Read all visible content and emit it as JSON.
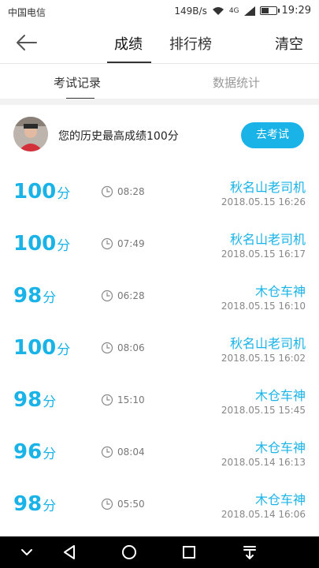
{
  "status_bar": {
    "carrier": "中国电信",
    "speed": "149B/s",
    "network_small": "4G",
    "time": "19:29"
  },
  "header": {
    "tabs": [
      {
        "label": "成绩",
        "active": true
      },
      {
        "label": "排行榜",
        "active": false
      }
    ],
    "clear_label": "清空"
  },
  "sub_tabs": [
    {
      "label": "考试记录",
      "active": true
    },
    {
      "label": "数据统计",
      "active": false
    }
  ],
  "best": {
    "text": "您的历史最高成绩100分",
    "exam_button": "去考试"
  },
  "records": [
    {
      "score": "100",
      "unit": "分",
      "duration": "08:28",
      "name": "秋名山老司机",
      "datetime": "2018.05.15  16:26"
    },
    {
      "score": "100",
      "unit": "分",
      "duration": "07:49",
      "name": "秋名山老司机",
      "datetime": "2018.05.15  16:17"
    },
    {
      "score": "98",
      "unit": "分",
      "duration": "06:28",
      "name": "木仓车神",
      "datetime": "2018.05.15  16:10"
    },
    {
      "score": "100",
      "unit": "分",
      "duration": "08:06",
      "name": "秋名山老司机",
      "datetime": "2018.05.15  16:02"
    },
    {
      "score": "98",
      "unit": "分",
      "duration": "15:10",
      "name": "木仓车神",
      "datetime": "2018.05.15  15:45"
    },
    {
      "score": "96",
      "unit": "分",
      "duration": "08:04",
      "name": "木仓车神",
      "datetime": "2018.05.14  16:13"
    },
    {
      "score": "98",
      "unit": "分",
      "duration": "05:50",
      "name": "木仓车神",
      "datetime": "2018.05.14  16:06"
    }
  ],
  "colors": {
    "accent": "#1ab3e8",
    "navbar": "#000000"
  }
}
